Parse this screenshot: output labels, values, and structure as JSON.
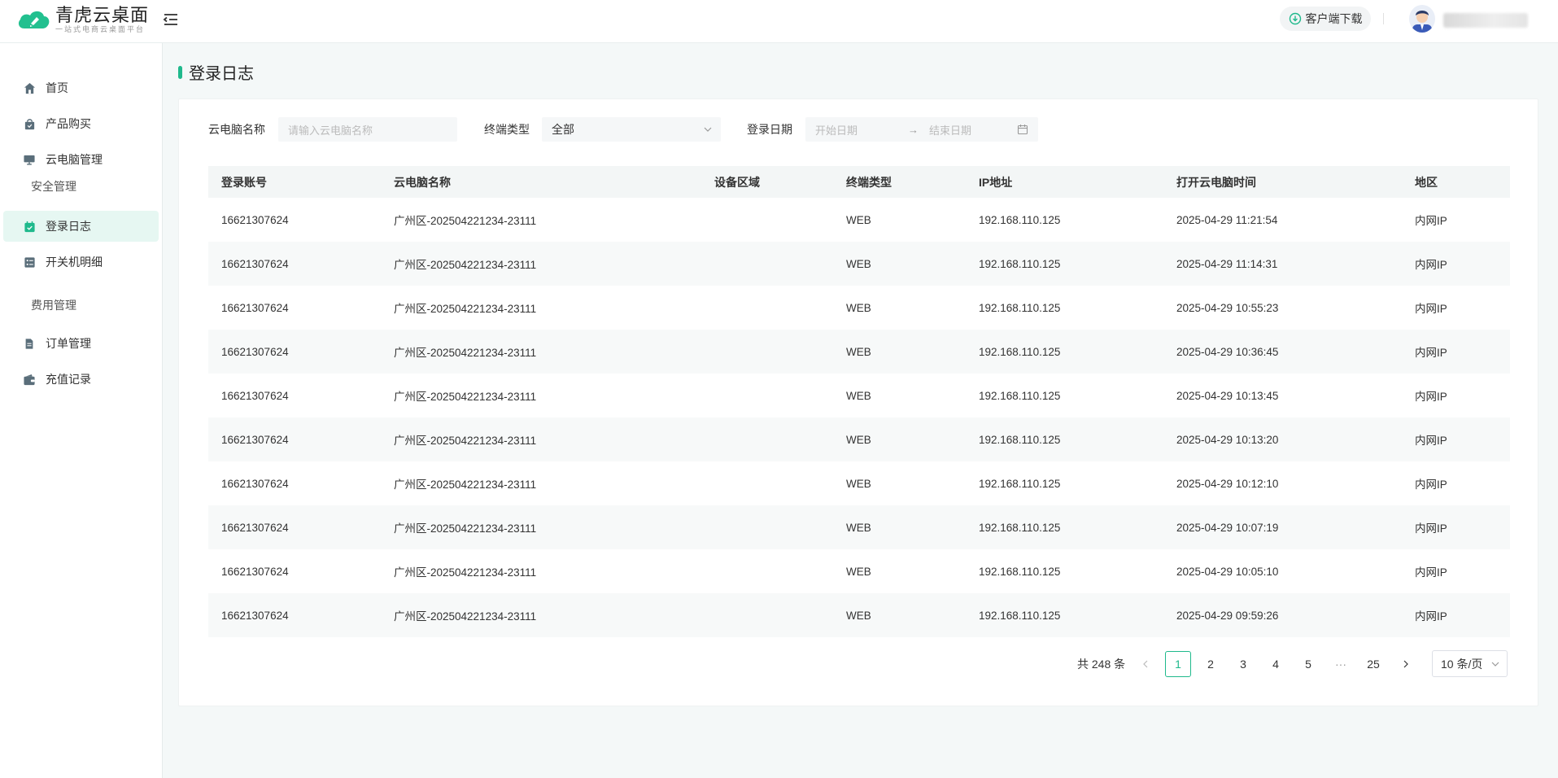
{
  "app": {
    "title": "青虎云桌面",
    "subtitle": "一站式电商云桌面平台",
    "download_label": "客户端下载",
    "accent": "#1fb98c"
  },
  "sidebar": {
    "items": [
      {
        "label": "首页",
        "icon": "home-icon"
      },
      {
        "label": "产品购买",
        "icon": "shopping-bag-icon"
      },
      {
        "label": "云电脑管理",
        "icon": "monitor-icon"
      },
      {
        "group": "安全管理"
      },
      {
        "label": "登录日志",
        "icon": "calendar-check-icon",
        "active": true
      },
      {
        "label": "开关机明细",
        "icon": "list-icon"
      },
      {
        "group": "费用管理"
      },
      {
        "label": "订单管理",
        "icon": "document-icon"
      },
      {
        "label": "充值记录",
        "icon": "wallet-icon"
      }
    ]
  },
  "page": {
    "title": "登录日志"
  },
  "filters": {
    "pc_name_label": "云电脑名称",
    "pc_name_placeholder": "请输入云电脑名称",
    "terminal_label": "终端类型",
    "terminal_value": "全部",
    "date_label": "登录日期",
    "start_placeholder": "开始日期",
    "end_placeholder": "结束日期"
  },
  "table": {
    "columns": [
      "登录账号",
      "云电脑名称",
      "设备区域",
      "终端类型",
      "IP地址",
      "打开云电脑时间",
      "地区"
    ],
    "rows": [
      [
        "16621307624",
        "广州区-202504221234-23111",
        "",
        "WEB",
        "192.168.110.125",
        "2025-04-29 11:21:54",
        "内网IP"
      ],
      [
        "16621307624",
        "广州区-202504221234-23111",
        "",
        "WEB",
        "192.168.110.125",
        "2025-04-29 11:14:31",
        "内网IP"
      ],
      [
        "16621307624",
        "广州区-202504221234-23111",
        "",
        "WEB",
        "192.168.110.125",
        "2025-04-29 10:55:23",
        "内网IP"
      ],
      [
        "16621307624",
        "广州区-202504221234-23111",
        "",
        "WEB",
        "192.168.110.125",
        "2025-04-29 10:36:45",
        "内网IP"
      ],
      [
        "16621307624",
        "广州区-202504221234-23111",
        "",
        "WEB",
        "192.168.110.125",
        "2025-04-29 10:13:45",
        "内网IP"
      ],
      [
        "16621307624",
        "广州区-202504221234-23111",
        "",
        "WEB",
        "192.168.110.125",
        "2025-04-29 10:13:20",
        "内网IP"
      ],
      [
        "16621307624",
        "广州区-202504221234-23111",
        "",
        "WEB",
        "192.168.110.125",
        "2025-04-29 10:12:10",
        "内网IP"
      ],
      [
        "16621307624",
        "广州区-202504221234-23111",
        "",
        "WEB",
        "192.168.110.125",
        "2025-04-29 10:07:19",
        "内网IP"
      ],
      [
        "16621307624",
        "广州区-202504221234-23111",
        "",
        "WEB",
        "192.168.110.125",
        "2025-04-29 10:05:10",
        "内网IP"
      ],
      [
        "16621307624",
        "广州区-202504221234-23111",
        "",
        "WEB",
        "192.168.110.125",
        "2025-04-29 09:59:26",
        "内网IP"
      ]
    ]
  },
  "pagination": {
    "total_label": "共 248 条",
    "pages": [
      "1",
      "2",
      "3",
      "4",
      "5"
    ],
    "ellipsis": "···",
    "last_page": "25",
    "current": "1",
    "page_size": "10 条/页"
  }
}
